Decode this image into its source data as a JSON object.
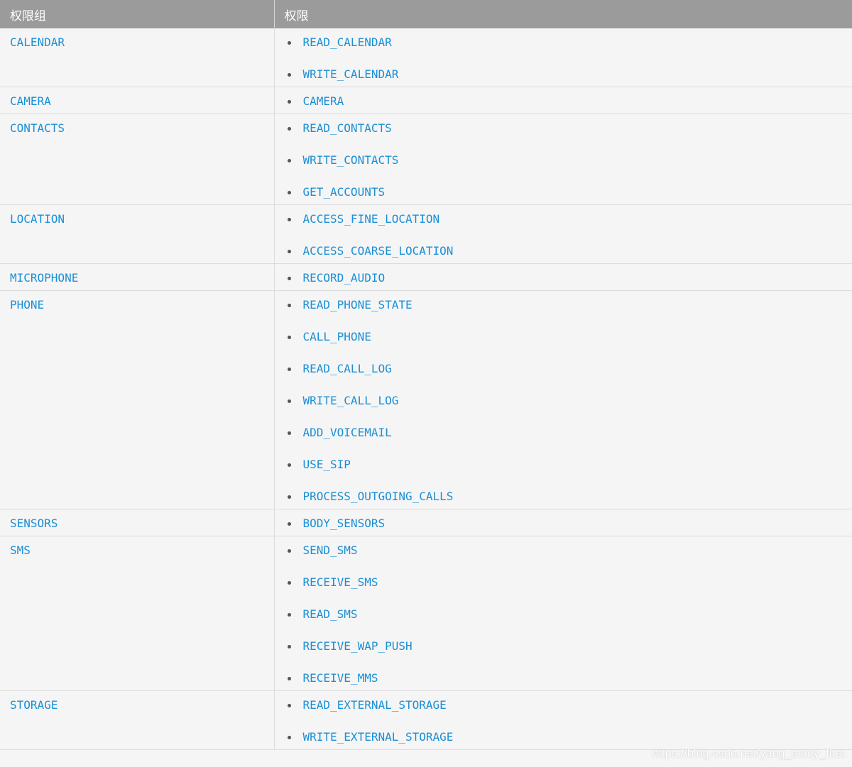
{
  "table": {
    "headers": [
      "权限组",
      "权限"
    ],
    "rows": [
      {
        "group": "CALENDAR",
        "permissions": [
          "READ_CALENDAR",
          "WRITE_CALENDAR"
        ]
      },
      {
        "group": "CAMERA",
        "permissions": [
          "CAMERA"
        ]
      },
      {
        "group": "CONTACTS",
        "permissions": [
          "READ_CONTACTS",
          "WRITE_CONTACTS",
          "GET_ACCOUNTS"
        ]
      },
      {
        "group": "LOCATION",
        "permissions": [
          "ACCESS_FINE_LOCATION",
          "ACCESS_COARSE_LOCATION"
        ]
      },
      {
        "group": "MICROPHONE",
        "permissions": [
          "RECORD_AUDIO"
        ]
      },
      {
        "group": "PHONE",
        "permissions": [
          "READ_PHONE_STATE",
          "CALL_PHONE",
          "READ_CALL_LOG",
          "WRITE_CALL_LOG",
          "ADD_VOICEMAIL",
          "USE_SIP",
          "PROCESS_OUTGOING_CALLS"
        ]
      },
      {
        "group": "SENSORS",
        "permissions": [
          "BODY_SENSORS"
        ]
      },
      {
        "group": "SMS",
        "permissions": [
          "SEND_SMS",
          "RECEIVE_SMS",
          "READ_SMS",
          "RECEIVE_WAP_PUSH",
          "RECEIVE_MMS"
        ]
      },
      {
        "group": "STORAGE",
        "permissions": [
          "READ_EXTERNAL_STORAGE",
          "WRITE_EXTERNAL_STORAGE"
        ]
      }
    ]
  },
  "watermark": "https://blog.csdn.net/yang_study_first",
  "colors": {
    "header_bg": "#9b9b9b",
    "link": "#1a8fd6",
    "row_bg": "#f5f5f5",
    "border": "#dcdcdc"
  }
}
